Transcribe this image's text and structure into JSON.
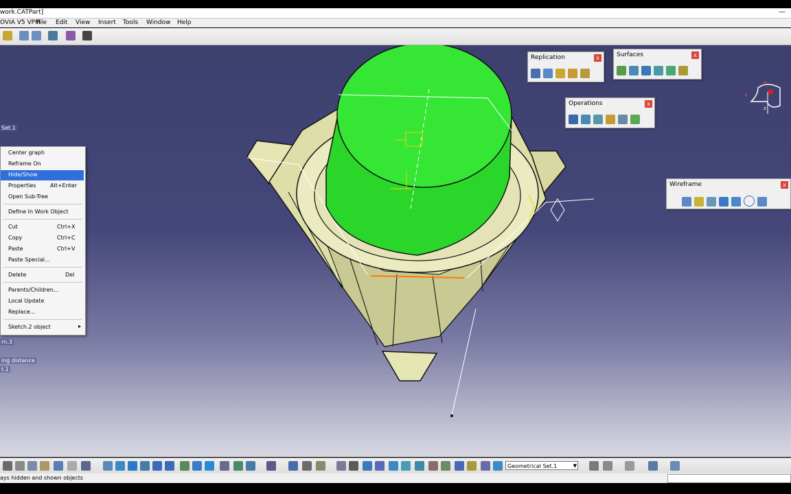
{
  "window": {
    "title": "work.CATPart]",
    "min_glyph": "—"
  },
  "menu": {
    "app": "OVIA V5 VPM",
    "file": "File",
    "edit": "Edit",
    "view": "View",
    "insert": "Insert",
    "tools": "Tools",
    "window": "Window",
    "help": "Help"
  },
  "tree": {
    "set1": "Set.1",
    "rn3": "rn.3",
    "distance": "ing distance",
    "t1": "t.1"
  },
  "palettes": {
    "replication": {
      "title": "Replication",
      "close": "x"
    },
    "surfaces": {
      "title": "Surfaces",
      "close": "x"
    },
    "operations": {
      "title": "Operations",
      "close": "x"
    },
    "wireframe": {
      "title": "Wireframe",
      "close": "x"
    }
  },
  "compass": {
    "x": "x",
    "y": "y",
    "z": "z"
  },
  "context_menu": {
    "items": [
      {
        "label": "Center graph",
        "shortcut": ""
      },
      {
        "label": "Reframe On",
        "shortcut": ""
      },
      {
        "label": "Hide/Show",
        "shortcut": ""
      },
      {
        "label": "Properties",
        "shortcut": "Alt+Enter"
      },
      {
        "label": "Open Sub-Tree",
        "shortcut": ""
      },
      {
        "label": "Define In Work Object",
        "shortcut": ""
      },
      {
        "label": "Cut",
        "shortcut": "Ctrl+X"
      },
      {
        "label": "Copy",
        "shortcut": "Ctrl+C"
      },
      {
        "label": "Paste",
        "shortcut": "Ctrl+V"
      },
      {
        "label": "Paste Special...",
        "shortcut": ""
      },
      {
        "label": "Delete",
        "shortcut": "Del"
      },
      {
        "label": "Parents/Children...",
        "shortcut": ""
      },
      {
        "label": "Local Update",
        "shortcut": ""
      },
      {
        "label": "Replace...",
        "shortcut": ""
      },
      {
        "label": "Sketch.2 object",
        "shortcut": ""
      }
    ],
    "submenu_arrow": "▸"
  },
  "bottom_toolbar": {
    "geometrical_set": "Geometrical Set.1"
  },
  "status": {
    "text": "ays hidden and shown objects"
  },
  "colors": {
    "viewport_top": "#3d3f6d",
    "highlight": "#2f6fdc",
    "pad": "#2bd62b",
    "part": "#e6e6b4"
  }
}
